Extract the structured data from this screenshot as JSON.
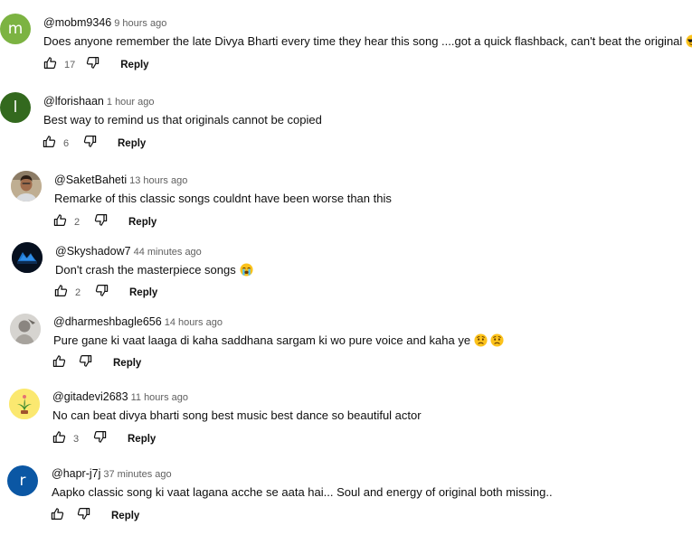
{
  "comments": [
    {
      "author": "@mobm9346",
      "time": "9 hours ago",
      "text": "Does anyone remember the late Divya Bharti every time they hear this song ....got a quick flashback, can't beat the original",
      "emojis": [
        "cool-sunglasses-emoji"
      ],
      "likes": "17",
      "reply_label": "Reply",
      "avatar": {
        "letter": "m",
        "color": "#7cb342"
      }
    },
    {
      "author": "@lforishaan",
      "time": "1 hour ago",
      "text": "Best way to remind us that originals cannot be copied",
      "emojis": [],
      "likes": "6",
      "reply_label": "Reply",
      "avatar": {
        "letter": "l",
        "color": "#33691e"
      }
    },
    {
      "author": "@SaketBaheti",
      "time": "13 hours ago",
      "text": "Remarke of this classic songs couldnt have been worse than this",
      "emojis": [],
      "likes": "2",
      "reply_label": "Reply",
      "avatar": {
        "letter": "",
        "color": "#c9b89c"
      }
    },
    {
      "author": "@Skyshadow7",
      "time": "44 minutes ago",
      "text": "Don't crash the masterpiece songs",
      "emojis": [
        "loudly-crying-face-emoji"
      ],
      "likes": "2",
      "reply_label": "Reply",
      "avatar": {
        "letter": "",
        "color": "#0b1a2e"
      }
    },
    {
      "author": "@dharmeshbagle656",
      "time": "14 hours ago",
      "text": "Pure gane ki vaat laaga di kaha saddhana sargam ki wo pure voice and kaha ye",
      "emojis": [
        "worried-face-emoji",
        "worried-face-emoji"
      ],
      "likes": "",
      "reply_label": "Reply",
      "avatar": {
        "letter": "",
        "color": "#d8d8d8"
      }
    },
    {
      "author": "@gitadevi2683",
      "time": "11 hours ago",
      "text": "No can beat divya bharti song best music best dance so beautiful actor",
      "emojis": [],
      "likes": "3",
      "reply_label": "Reply",
      "avatar": {
        "letter": "",
        "color": "#fff176"
      }
    },
    {
      "author": "@hapr-j7j",
      "time": "37 minutes ago",
      "text": "Aapko classic song ki vaat lagana acche se aata hai... Soul and energy of original both missing..",
      "emojis": [],
      "likes": "",
      "reply_label": "Reply",
      "avatar": {
        "letter": "r",
        "color": "#0b57a4"
      }
    }
  ]
}
